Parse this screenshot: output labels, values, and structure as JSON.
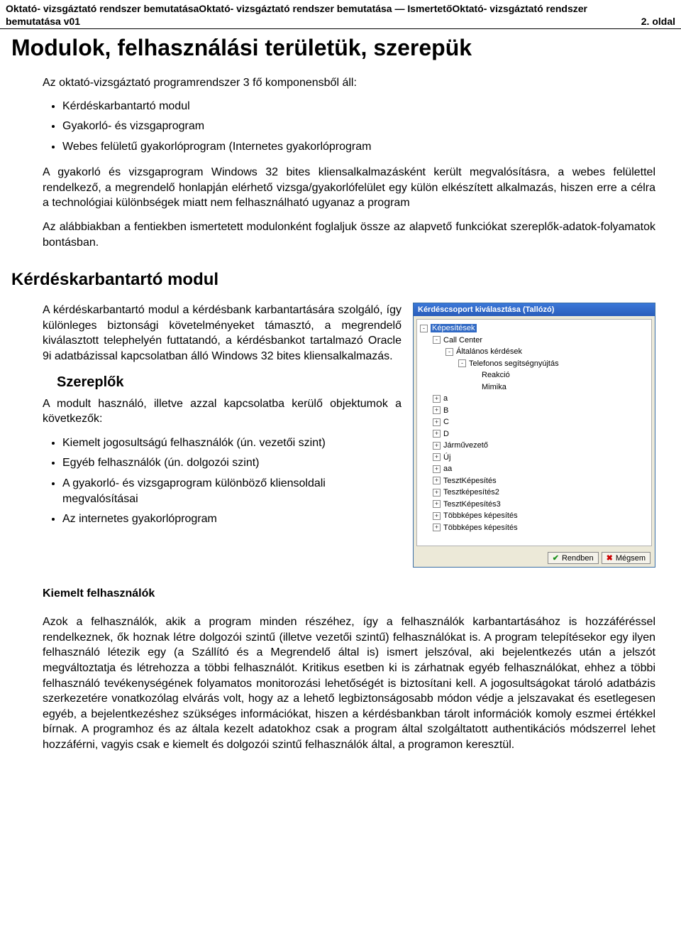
{
  "header": {
    "line1": "Oktató- vizsgáztató rendszer bemutatásaOktató- vizsgáztató rendszer bemutatása — IsmertetőOktató- vizsgáztató rendszer",
    "line2_left": "bemutatása v01",
    "line2_right": "2. oldal"
  },
  "title": "Modulok, felhasználási területük, szerepük",
  "intro": {
    "lead": "Az oktató-vizsgáztató programrendszer 3 fő komponensből áll:",
    "bullets": [
      "Kérdéskarbantartó modul",
      "Gyakorló- és vizsgaprogram",
      "Webes felületű gyakorlóprogram (Internetes gyakorlóprogram"
    ],
    "para1": "A gyakorló és vizsgaprogram Windows 32 bites kliensalkalmazásként került megvalósításra, a webes felülettel rendelkező, a megrendelő honlapján elérhető vizsga/gyakorlófelület egy külön elkészített alkalmazás, hiszen erre a célra a technológiai különbségek miatt nem felhasználható ugyanaz a program",
    "para2": "Az alábbiakban a fentiekben ismertetett modulonként foglaljuk össze az alapvető funkciókat szereplők-adatok-folyamatok bontásban."
  },
  "section2": {
    "heading": "Kérdéskarbantartó modul",
    "para": "A kérdéskarbantartó modul a kérdésbank karbantartására szolgáló, így különleges biztonsági követelményeket támasztó, a megrendelő kiválasztott telephelyén futtatandó, a kérdésbankot tartalmazó Oracle 9i adatbázissal kapcsolatban álló Windows 32 bites kliensalkalmazás.",
    "sub_heading": "Szereplők",
    "sub_lead": "A modult használó, illetve azzal kapcsolatba kerülő objektumok a következők:",
    "bullets": [
      "Kiemelt jogosultságú felhasználók (ún. vezetői szint)",
      "Egyéb felhasználók (ún. dolgozói szint)",
      "A gyakorló- és vizsgaprogram különböző kliensoldali megvalósításai",
      "Az internetes gyakorlóprogram"
    ]
  },
  "screenshot": {
    "title": "Kérdéscsoport kiválasztása (Tallózó)",
    "root": "Képesítések",
    "level1": "Call Center",
    "level2": "Általános kérdések",
    "level3": "Telefonos segítségnyújtás",
    "leaves": [
      "Reakció",
      "Mimika"
    ],
    "items": [
      "a",
      "B",
      "C",
      "D",
      "Járművezető",
      "Új",
      "aa",
      "TesztKépesítés",
      "Tesztképesítés2",
      "TesztKépesítés3",
      "Többképes képesítés",
      "Többképes képesítés"
    ],
    "btn_ok": "Rendben",
    "btn_cancel": "Mégsem"
  },
  "kiemelt": {
    "heading": "Kiemelt felhasználók",
    "para": "Azok a felhasználók, akik a program minden részéhez, így a felhasználók karbantartásához is hozzáféréssel rendelkeznek, ők hoznak létre dolgozói szintű (illetve vezetői szintű) felhasználókat is. A program telepítésekor egy ilyen felhasználó létezik egy (a Szállító és a Megrendelő által is) ismert jelszóval, aki bejelentkezés után a jelszót megváltoztatja és létrehozza a többi felhasználót. Kritikus esetben ki is zárhatnak egyéb felhasználókat, ehhez a többi felhasználó tevékenységének folyamatos monitorozási lehetőségét is biztosítani kell. A jogosultságokat tároló adatbázis szerkezetére vonatkozólag elvárás volt, hogy az a lehető legbiztonságosabb módon védje a jelszavakat és esetlegesen egyéb, a bejelentkezéshez szükséges információkat, hiszen a kérdésbankban tárolt információk komoly eszmei értékkel bírnak. A programhoz és az általa kezelt adatokhoz csak a program által szolgáltatott authentikációs módszerrel lehet hozzáférni, vagyis csak e kiemelt és dolgozói szintű felhasználók által, a programon keresztül."
  }
}
